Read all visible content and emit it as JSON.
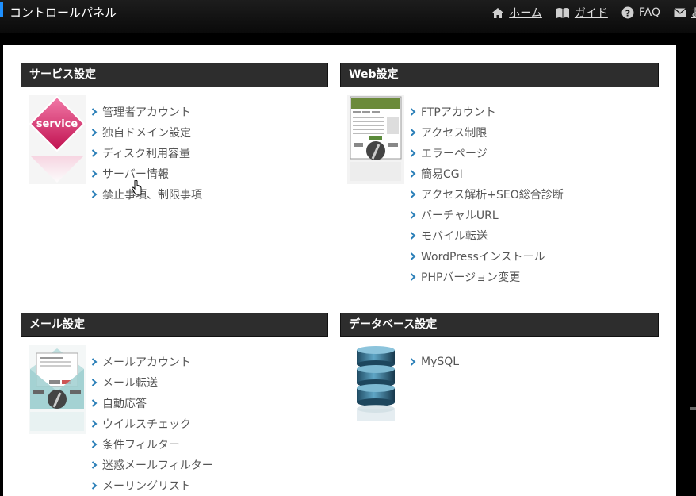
{
  "header": {
    "title": "コントロールパネル",
    "nav": [
      {
        "icon": "home-icon",
        "label": "ホーム"
      },
      {
        "icon": "book-icon",
        "label": "ガイド"
      },
      {
        "icon": "help-icon",
        "label": "FAQ"
      },
      {
        "icon": "mail-icon",
        "label": "お"
      }
    ]
  },
  "sections": {
    "service": {
      "title": "サービス設定",
      "thumb_label": "service",
      "items": [
        "管理者アカウント",
        "独自ドメイン設定",
        "ディスク利用容量",
        "サーバー情報",
        "禁止事項、制限事項"
      ]
    },
    "web": {
      "title": "Web設定",
      "items": [
        "FTPアカウント",
        "アクセス制限",
        "エラーページ",
        "簡易CGI",
        "アクセス解析+SEO総合診断",
        "バーチャルURL",
        "モバイル転送",
        "WordPressインストール",
        "PHPバージョン変更"
      ]
    },
    "mail": {
      "title": "メール設定",
      "items": [
        "メールアカウント",
        "メール転送",
        "自動応答",
        "ウイルスチェック",
        "条件フィルター",
        "迷惑メールフィルター",
        "メーリングリスト"
      ]
    },
    "database": {
      "title": "データベース設定",
      "items": [
        "MySQL"
      ]
    }
  },
  "colors": {
    "accent": "#1e90ff",
    "header_bg": "#2d2d2d",
    "chevron": "#2a7fb8"
  }
}
